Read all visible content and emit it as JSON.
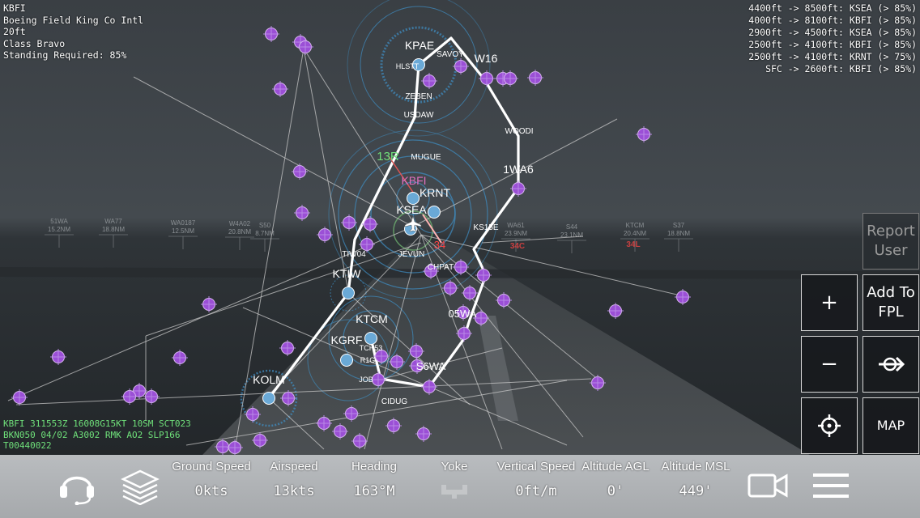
{
  "airport_info": {
    "icao": "KBFI",
    "name": "Boeing Field King Co Intl",
    "elevation": "20ft",
    "class": "Class Bravo",
    "standing": "Standing Required: 85%"
  },
  "airspace_list": [
    "4400ft -> 8500ft: KSEA (> 85%)",
    "4000ft -> 8100ft: KBFI (> 85%)",
    "2900ft -> 4500ft: KSEA (> 85%)",
    "2500ft -> 4100ft: KBFI (> 85%)",
    "2500ft -> 4100ft: KRNT (> 75%)",
    "SFC -> 2600ft: KBFI (> 85%)"
  ],
  "metar": [
    "KBFI 311553Z 16008G15KT 10SM SCT023",
    "BKN050 04/02 A3002 RMK AO2 SLP166",
    "T00440022"
  ],
  "map_labels": {
    "airports": [
      "KPAE",
      "KBFI",
      "KRNT",
      "KSEA",
      "KTIW",
      "KTCM",
      "KGRF",
      "KOLM"
    ],
    "fixes": [
      "W16",
      "SAVOY",
      "ZEBEN",
      "USDAW",
      "WOODI",
      "1WA6",
      "MUGUE",
      "TIW04",
      "JEVUN",
      "CHPAT",
      "KS15E",
      "S6WA",
      "CIDUG",
      "JOB",
      "TCH53",
      "R1G",
      "HLSTT",
      "05WA"
    ],
    "runway_active": "13R",
    "runway_near": "34"
  },
  "horizon_labels": [
    {
      "name": "51WA",
      "dist": "15.2NM"
    },
    {
      "name": "WA77",
      "dist": "18.8NM"
    },
    {
      "name": "WA0187",
      "dist": "12.5NM"
    },
    {
      "name": "W4A02",
      "dist": "20.8NM"
    },
    {
      "name": "S50",
      "dist": "8.7NM"
    },
    {
      "name": "WA61",
      "dist": "23.9NM"
    },
    {
      "name": "S44",
      "dist": "23.1NM"
    },
    {
      "name": "KTCM",
      "dist": "20.4NM"
    },
    {
      "name": "S37",
      "dist": "18.8NM"
    }
  ],
  "horizon_runways": [
    "34C",
    "34L"
  ],
  "right_buttons": {
    "report_user": "Report\nUser",
    "zoom_in": "+",
    "add_to_fpl": "Add To\nFPL",
    "zoom_out": "−",
    "map": "MAP"
  },
  "gauges": [
    {
      "label": "Ground Speed",
      "value": "0kts"
    },
    {
      "label": "Airspeed",
      "value": "13kts"
    },
    {
      "label": "Heading",
      "value": "163°M"
    },
    {
      "label": "Yoke",
      "value": ""
    },
    {
      "label": "Vertical Speed",
      "value": "0ft/m"
    },
    {
      "label": "Altitude AGL",
      "value": "0'"
    },
    {
      "label": "Altitude MSL",
      "value": "449'"
    }
  ],
  "colors": {
    "accent_purple": "#9b4fd6",
    "airport_blue": "#6aa9d6",
    "route_white": "#ffffff",
    "metar_green": "#6fe07a"
  },
  "icons": [
    "headset-icon",
    "layers-icon",
    "plane-icon",
    "camera-icon",
    "menu-icon",
    "crosshair-icon",
    "direct-to-icon",
    "yoke-icon"
  ]
}
